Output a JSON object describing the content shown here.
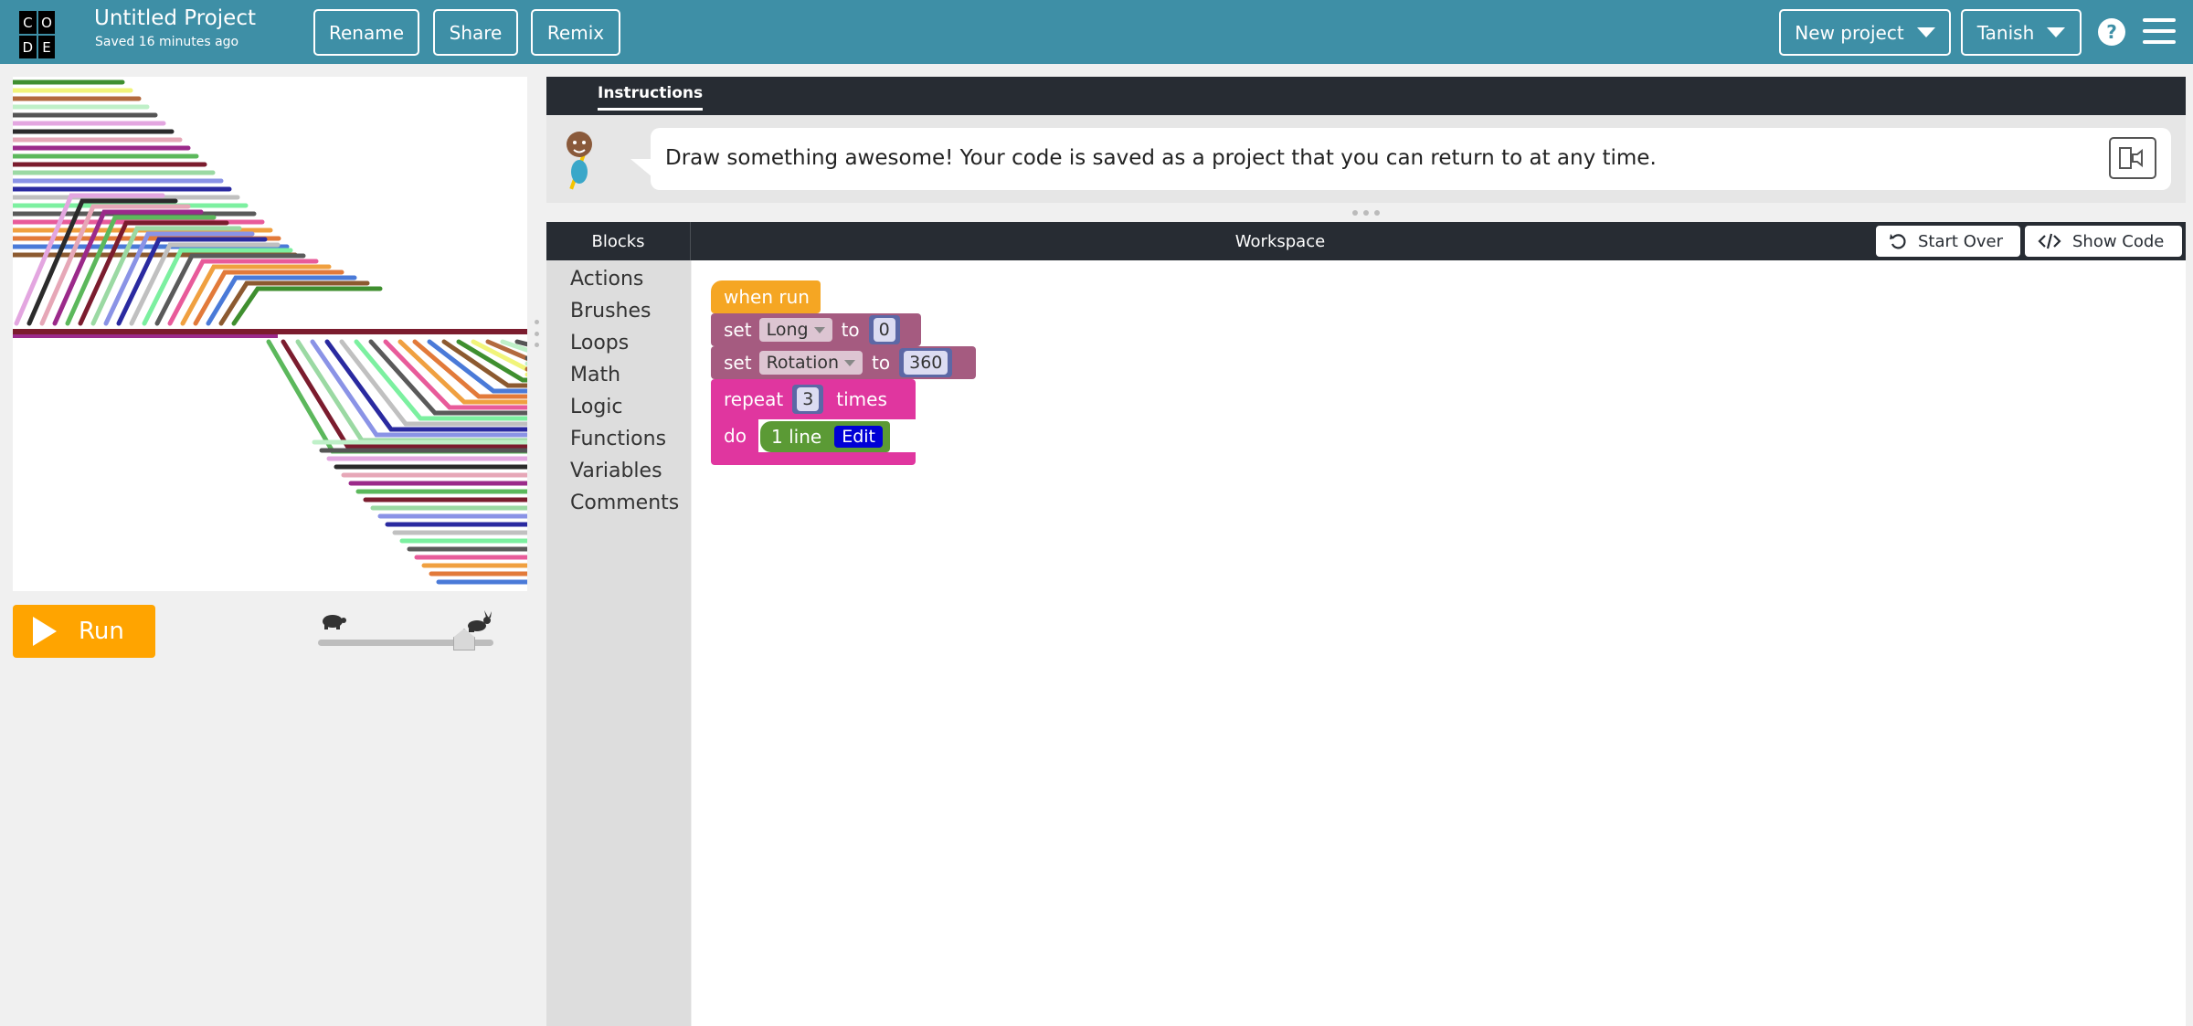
{
  "header": {
    "logo_letters": [
      "C",
      "O",
      "D",
      "E"
    ],
    "project_title": "Untitled Project",
    "saved_status": "Saved 16 minutes ago",
    "rename_label": "Rename",
    "share_label": "Share",
    "remix_label": "Remix",
    "new_project_label": "New project",
    "user_label": "Tanish",
    "help_symbol": "?",
    "bg_color": "#3e8fa6"
  },
  "run": {
    "label": "Run",
    "color": "#ffa400",
    "speed_fraction": 0.88
  },
  "instructions": {
    "tab_label": "Instructions",
    "text": "Draw something awesome! Your code is saved as a project that you can return to at any time."
  },
  "workspace_header": {
    "blocks_title": "Blocks",
    "workspace_title": "Workspace",
    "start_over_label": "Start Over",
    "show_code_label": "Show Code"
  },
  "toolbox": {
    "categories": [
      "Actions",
      "Brushes",
      "Loops",
      "Math",
      "Logic",
      "Functions",
      "Variables",
      "Comments"
    ]
  },
  "blocks": {
    "when_run": "when run",
    "set1": {
      "keyword": "set",
      "variable": "Long",
      "to": "to",
      "value": "0"
    },
    "set2": {
      "keyword": "set",
      "variable": "Rotation",
      "to": "to",
      "value": "360"
    },
    "repeat": {
      "keyword": "repeat",
      "count": "3",
      "times": "times",
      "do": "do"
    },
    "function_call": {
      "name": "1 line",
      "edit": "Edit"
    },
    "colors": {
      "event": "#f5a623",
      "variable": "#a55b80",
      "math": "#5c68a6",
      "loop": "#e0369f",
      "function": "#5b9a35",
      "edit": "#0000d6"
    }
  },
  "icons": [
    "play-icon",
    "turtle-icon",
    "rabbit-icon",
    "speaker-book-icon",
    "undo-icon",
    "code-icon",
    "chevron-down-icon",
    "hamburger-icon",
    "help-icon"
  ]
}
